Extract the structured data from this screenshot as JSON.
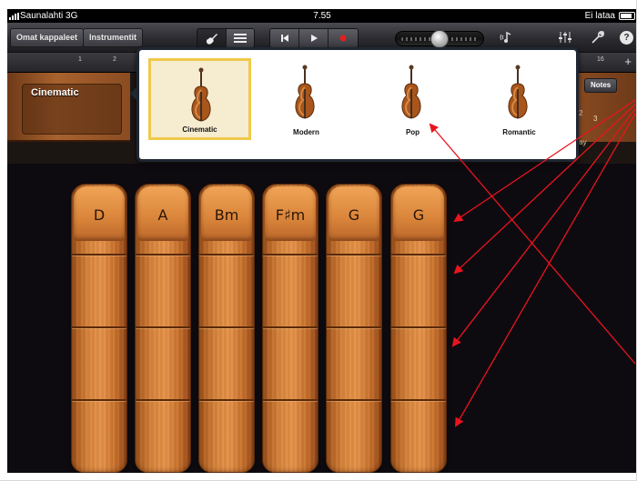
{
  "status_bar": {
    "carrier": "Saunalahti 3G",
    "time": "7.55",
    "charging": "Ei lataa"
  },
  "toolbar": {
    "my_songs_label": "Omat kappaleet",
    "instruments_label": "Instrumentit",
    "help_label": "?"
  },
  "ruler": {
    "ticks": [
      "1",
      "2",
      "16"
    ],
    "add_label": "+"
  },
  "track": {
    "name": "Cinematic",
    "notes_label": "Notes",
    "numbers": [
      "2",
      "3"
    ],
    "autoplay_label": "play"
  },
  "popover": {
    "presets": [
      {
        "name": "Cinematic",
        "selected": true
      },
      {
        "name": "Modern",
        "selected": false
      },
      {
        "name": "Pop",
        "selected": false
      },
      {
        "name": "Romantic",
        "selected": false
      }
    ]
  },
  "chord_strips": [
    "D",
    "A",
    "Bm",
    "F♯m",
    "G",
    "G"
  ],
  "colors": {
    "annotation_arrow": "#e8141e",
    "selected_border": "#f0c94a",
    "wood": "#e69248"
  }
}
